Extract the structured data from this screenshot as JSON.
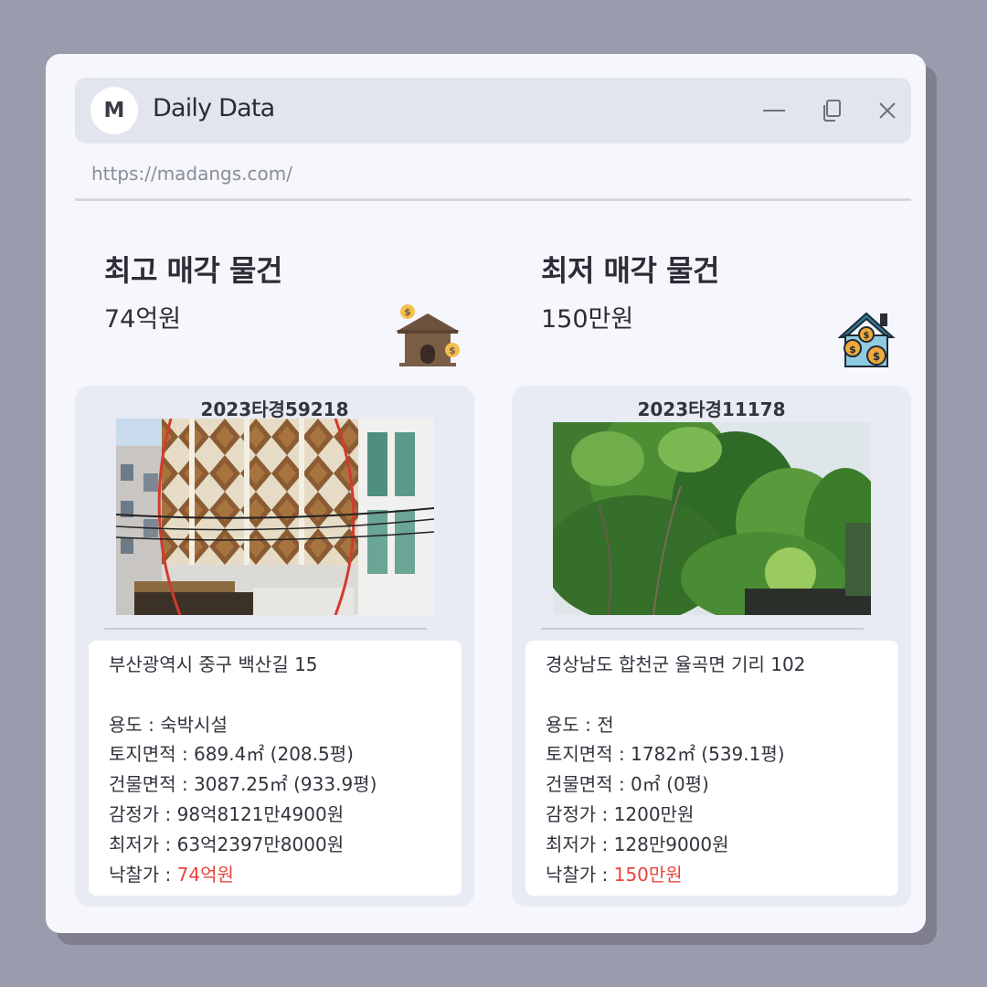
{
  "app": {
    "logo_letter": "M",
    "title": "Daily Data",
    "url": "https://madangs.com/"
  },
  "window_controls": [
    "minimize-icon",
    "restore-icon",
    "close-icon"
  ],
  "highest": {
    "heading": "최고 매각 물건",
    "amount": "74억원",
    "icon": "house-money-icon",
    "case_no": "2023타경59218",
    "address": "부산광역시 중구 백산길 15",
    "usage": "용도 : 숙박시설",
    "land_area": "토지면적 : 689.4㎡ (208.5평)",
    "building_area": "건물면적 : 3087.25㎡ (933.9평)",
    "appraisal": "감정가 : 98억8121만4900원",
    "minimum": "최저가 : 63억2397만8000원",
    "winning_label": "낙찰가 : ",
    "winning_value": "74억원"
  },
  "lowest": {
    "heading": "최저 매각 물건",
    "amount": "150만원",
    "icon": "house-coins-icon",
    "case_no": "2023타경11178",
    "address": "경상남도 합천군 율곡면 기리 102",
    "usage": "용도 : 전",
    "land_area": "토지면적 : 1782㎡ (539.1평)",
    "building_area": "건물면적 : 0㎡ (0평)",
    "appraisal": "감정가 : 1200만원",
    "minimum": "최저가 : 128만9000원",
    "winning_label": "낙찰가 : ",
    "winning_value": "150만원"
  },
  "colors": {
    "accent_red": "#e8453c",
    "window_bg": "#f6f7fc",
    "titlebar_bg": "#e3e5ee",
    "page_bg": "#9a9bad"
  }
}
